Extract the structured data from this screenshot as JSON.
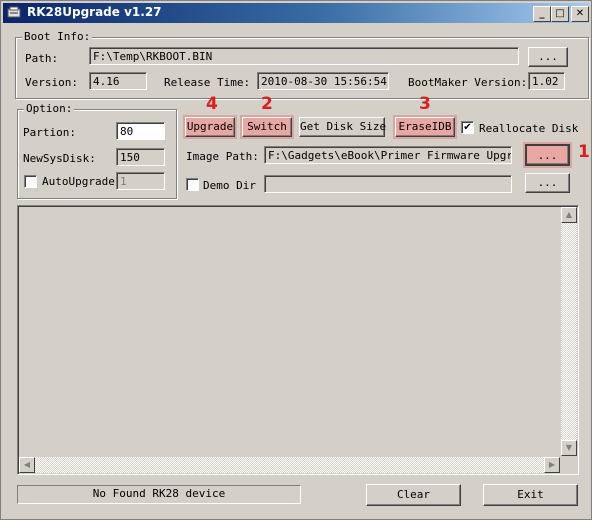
{
  "window": {
    "title": "RK28Upgrade v1.27",
    "controls": {
      "minimize": "_",
      "maximize": "□",
      "close": "✕"
    }
  },
  "boot_info": {
    "group_label": "Boot Info:",
    "path_label": "Path:",
    "path_value": "F:\\Temp\\RKBOOT.BIN",
    "browse_label": "...",
    "version_label": "Version:",
    "version_value": "4.16",
    "release_time_label": "Release Time:",
    "release_time_value": "2010-08-30 15:56:54",
    "bootmaker_label": "BootMaker Version:",
    "bootmaker_value": "1.02"
  },
  "option": {
    "group_label": "Option:",
    "partion_label": "Partion:",
    "partion_value": "80",
    "newsysdisk_label": "NewSysDisk:",
    "newsysdisk_value": "150",
    "autoupgrade_label": "AutoUpgrade",
    "autoupgrade_checked": false,
    "autoupgrade_value": "1"
  },
  "actions": {
    "upgrade_label": "Upgrade",
    "switch_label": "Switch",
    "get_disk_size_label": "Get Disk Size",
    "erase_idb_label": "EraseIDB",
    "reallocate_label": "Reallocate Disk",
    "reallocate_checked": true,
    "check_glyph": "✔"
  },
  "image": {
    "path_label": "Image Path:",
    "path_value": "F:\\Gadgets\\eBook\\Primer Firmware Upgrade'",
    "browse_label": "...",
    "demo_dir_label": "Demo Dir",
    "demo_dir_checked": false,
    "demo_dir_value": "",
    "demo_browse_label": "..."
  },
  "annotations": {
    "upgrade": "4",
    "switch": "2",
    "erase": "3",
    "browse": "1",
    "color": "#e21b1b"
  },
  "log": {
    "scroll_up": "▲",
    "scroll_down": "▼",
    "scroll_left": "◀",
    "scroll_right": "▶"
  },
  "footer": {
    "status_text": "No Found RK28 device",
    "clear_label": "Clear",
    "exit_label": "Exit"
  }
}
